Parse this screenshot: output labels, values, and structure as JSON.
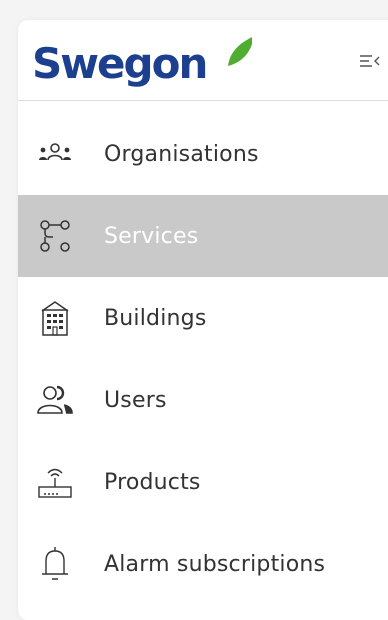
{
  "brand": {
    "name": "Swegon",
    "text_color": "#1d3f8f",
    "leaf_color": "#4fae31"
  },
  "header": {
    "collapse_icon": "collapse-sidebar-icon"
  },
  "nav": {
    "items": [
      {
        "label": "Organisations",
        "icon": "organisations-icon",
        "active": false
      },
      {
        "label": "Services",
        "icon": "services-icon",
        "active": true
      },
      {
        "label": "Buildings",
        "icon": "building-icon",
        "active": false
      },
      {
        "label": "Users",
        "icon": "users-icon",
        "active": false
      },
      {
        "label": "Products",
        "icon": "products-icon",
        "active": false
      },
      {
        "label": "Alarm subscriptions",
        "icon": "bell-icon",
        "active": false
      }
    ]
  },
  "colors": {
    "active_bg": "#c9c9c9",
    "text": "#333333",
    "active_text": "#ffffff"
  }
}
